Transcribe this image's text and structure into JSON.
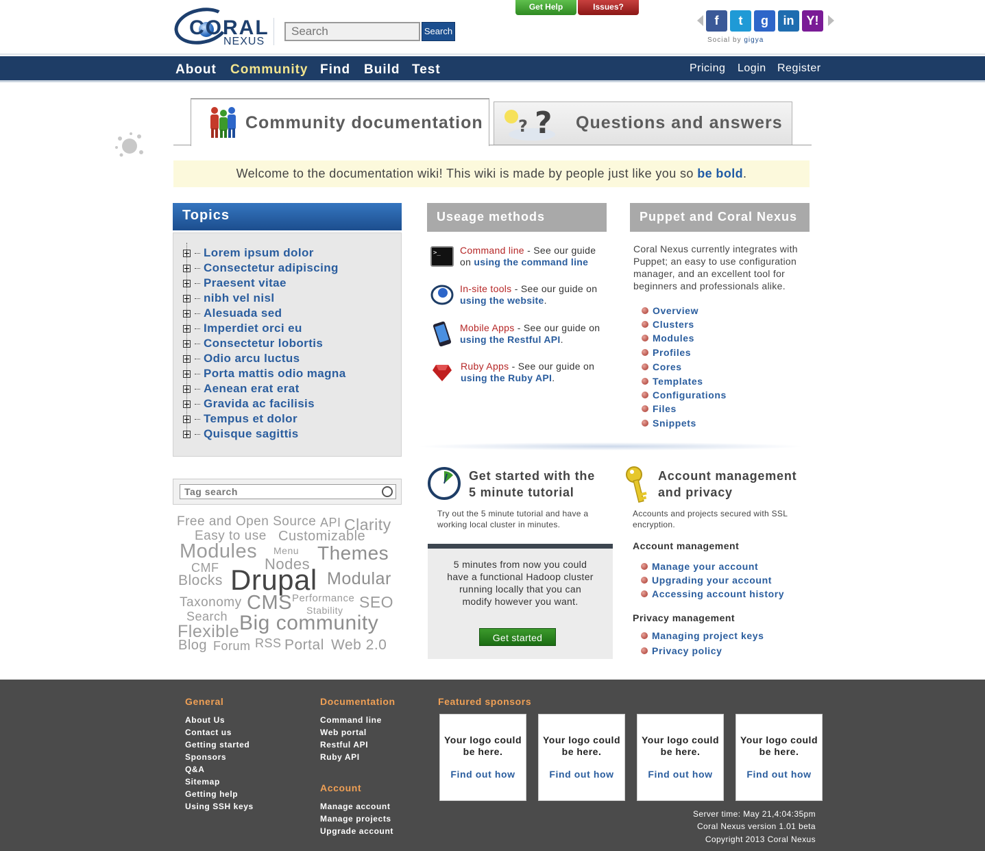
{
  "header": {
    "logo_word": "CORAL",
    "logo_sub": "NEXUS",
    "search_placeholder": "Search",
    "search_button": "Search",
    "get_help": "Get Help",
    "issues": "Issues?",
    "social_by": "Social by",
    "social_brand": "gigya",
    "social": [
      {
        "name": "facebook",
        "glyph": "f",
        "color": "#3b5998"
      },
      {
        "name": "twitter",
        "glyph": "t",
        "color": "#1f9ad6"
      },
      {
        "name": "google",
        "glyph": "g",
        "color": "#2d66c9"
      },
      {
        "name": "linkedin",
        "glyph": "in",
        "color": "#1f6db0"
      },
      {
        "name": "yahoo",
        "glyph": "Y!",
        "color": "#7a1b96"
      }
    ]
  },
  "nav": {
    "left": [
      "About",
      "Community",
      "Find",
      "Build",
      "Test"
    ],
    "active": "Community",
    "right": [
      "Pricing",
      "Login",
      "Register"
    ]
  },
  "tabs": {
    "doc": "Community documentation",
    "qa": "Questions and answers"
  },
  "welcome": {
    "text": "Welcome to the documentation wiki! This wiki is made by people just like you so ",
    "bold": "be bold",
    "end": "."
  },
  "topics": {
    "title": "Topics",
    "items": [
      "Lorem ipsum dolor",
      "Consectetur adipiscing",
      "Praesent vitae",
      "nibh vel nisl",
      "Alesuada sed",
      "Imperdiet orci eu",
      "Consectetur lobortis",
      "Odio arcu luctus",
      "Porta mattis odio magna",
      "Aenean erat erat",
      "Gravida ac facilisis",
      "Tempus et dolor",
      "Quisque sagittis"
    ]
  },
  "tag_search": {
    "placeholder": "Tag search",
    "tags": [
      "Free and Open Source",
      "API",
      "Clarity",
      "Easy to use",
      "Customizable",
      "Modules",
      "Menu",
      "Themes",
      "CMF",
      "Nodes",
      "Blocks",
      "Drupal",
      "Modular",
      "Taxonomy",
      "CMS",
      "Performance",
      "SEO",
      "Stability",
      "Search",
      "Big community",
      "Flexible",
      "Blog",
      "Forum",
      "RSS",
      "Portal",
      "Web 2.0"
    ]
  },
  "usage": {
    "title": "Useage methods",
    "items": [
      {
        "name": "Command line",
        "mid": " - See our guide on ",
        "link": "using the command line",
        "end": ""
      },
      {
        "name": "In-site tools",
        "mid": " - See our guide on ",
        "link": "using the website",
        "end": "."
      },
      {
        "name": "Mobile Apps",
        "mid": " - See our guide on ",
        "link": "using the Restful API",
        "end": "."
      },
      {
        "name": "Ruby Apps",
        "mid": " - See our guide on ",
        "link": "using the Ruby API",
        "end": "."
      }
    ]
  },
  "puppet": {
    "title": "Puppet and Coral Nexus",
    "text": "Coral Nexus currently integrates with Puppet; an easy to use configuration manager, and an excellent tool for beginners and professionals alike.",
    "links": [
      "Overview",
      "Clusters",
      "Modules",
      "Profiles",
      "Cores",
      "Templates",
      "Configurations",
      "Files",
      "Snippets"
    ]
  },
  "tutorial": {
    "title_1": "Get started with the",
    "title_2": "5 minute tutorial",
    "desc": "Try out the 5 minute tutorial and have a working local cluster in minutes.",
    "box_text": "5 minutes from now you could have a functional Hadoop cluster running locally that you can modify however you want.",
    "button": "Get started"
  },
  "account": {
    "title_1": "Account management",
    "title_2": "and privacy",
    "desc": "Accounts and projects secured with SSL encryption.",
    "mgmt_title": "Account management",
    "mgmt_links": [
      "Manage your account",
      "Upgrading your account",
      "Accessing account history"
    ],
    "privacy_title": "Privacy management",
    "privacy_links": [
      "Managing project keys",
      "Privacy policy"
    ]
  },
  "footer": {
    "general_title": "General",
    "general": [
      "About Us",
      "Contact us",
      "Getting started",
      "Sponsors",
      "Q&A",
      "Sitemap",
      "Getting help",
      "Using SSH keys"
    ],
    "doc_title": "Documentation",
    "doc": [
      "Command line",
      "Web portal",
      "Restful API",
      "Ruby API"
    ],
    "account_title": "Account",
    "account": [
      "Manage account",
      "Manage projects",
      "Upgrade account"
    ],
    "sponsors_title": "Featured sponsors",
    "sponsor_text": "Your logo could be here.",
    "sponsor_link": "Find out how",
    "server_time": "Server time: May 21,4:04:35pm",
    "version": "Coral Nexus version 1.01 beta",
    "copyright": "Copyright 2013 Coral Nexus"
  }
}
